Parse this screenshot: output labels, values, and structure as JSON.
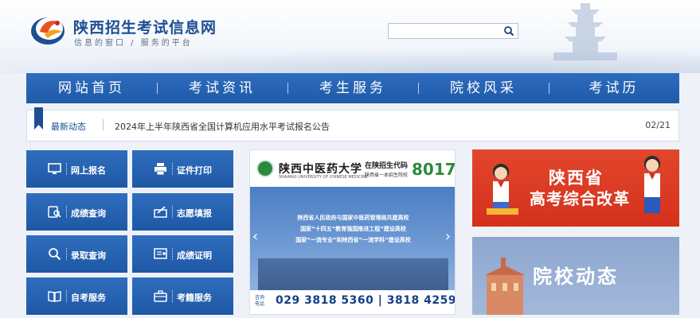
{
  "header": {
    "site_title": "陕西招生考试信息网",
    "slogan": "信息的窗口 / 服务的平台",
    "search_placeholder": "",
    "logo_icon": "phoenix-logo-icon",
    "search_icon": "search-icon"
  },
  "nav": {
    "items": [
      "网站首页",
      "考试资讯",
      "考生服务",
      "院校风采",
      "考试历"
    ]
  },
  "news": {
    "label": "最新动态",
    "headline": "2024年上半年陕西省全国计算机应用水平考试报名公告",
    "date": "02/21"
  },
  "services": [
    {
      "label": "网上报名",
      "icon": "monitor-icon"
    },
    {
      "label": "证件打印",
      "icon": "printer-icon"
    },
    {
      "label": "成绩查询",
      "icon": "search-score-icon"
    },
    {
      "label": "志愿填报",
      "icon": "form-fill-icon"
    },
    {
      "label": "录取查询",
      "icon": "magnifier-icon"
    },
    {
      "label": "成绩证明",
      "icon": "certificate-icon"
    },
    {
      "label": "自考服务",
      "icon": "book-icon"
    },
    {
      "label": "考籍服务",
      "icon": "briefcase-icon"
    }
  ],
  "banner": {
    "school_name": "陕西中医药大学",
    "school_name_en": "SHAANXI UNIVERSITY OF CHINESE MEDICINE",
    "code_label": "在陕招生代码",
    "code_sub": "陕西省一本招生院校",
    "code": "8017",
    "lines": [
      "陕西省人民政府与国家中医药管理局共建高校",
      "国家“十四五”教育强国推进工程”建设高校",
      "国家“一流专业”和陕西省“一流学科”建设高校"
    ],
    "consult_label": "咨询电话",
    "phone": "029 3818 5360 | 3818 4259"
  },
  "reform": {
    "line1": "陕西省",
    "line2": "高考综合改革"
  },
  "campus": {
    "title": "院校动态"
  },
  "colors": {
    "primary_blue": "#1f5aa8",
    "reform_red": "#d4311c",
    "campus_lavender": "#9bb0d5",
    "code_green": "#2c8b3b"
  }
}
